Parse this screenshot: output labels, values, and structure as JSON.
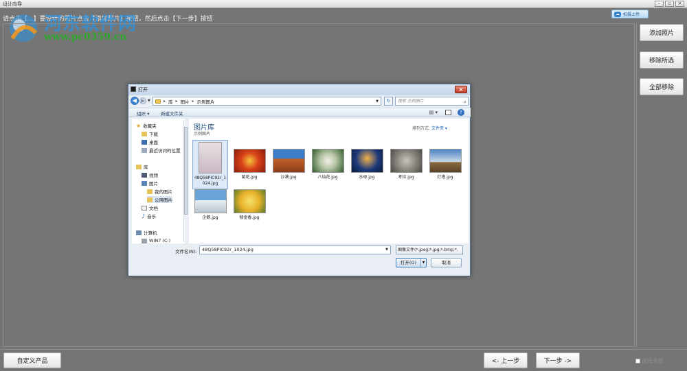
{
  "app": {
    "title": "设计向导",
    "instruction": "请点击【...】要设计的照片点击【添加照片】按钮，然后点击【下一步】按钮",
    "watermark": {
      "name": "河东软件网",
      "url": "www.pc0359.cn"
    },
    "upload_label": "拍摄上传"
  },
  "side_buttons": {
    "add": "添加照片",
    "remove_selected": "移除所选",
    "remove_all": "全部移除"
  },
  "bottom": {
    "custom": "自定义产品",
    "prev": "<- 上一步",
    "next": "下一步 ->",
    "select_all": "选择全部"
  },
  "dialog": {
    "title": "打开",
    "breadcrumb": [
      "库",
      "图片",
      "示例图片"
    ],
    "search_placeholder": "搜索 示例图片",
    "organize": "组织 ▾",
    "new_folder": "新建文件夹",
    "library_title": "图片库",
    "library_sub": "示例图片",
    "arrange_label": "排列方式:",
    "arrange_value": "文件夹 ▾",
    "nav": {
      "favorites": "收藏夹",
      "downloads": "下载",
      "desktop": "桌面",
      "recent": "最近访问的位置",
      "libraries": "库",
      "videos": "视频",
      "pictures": "图片",
      "my_pictures": "我的图片",
      "public_pictures": "公用图片",
      "documents": "文档",
      "music": "音乐",
      "computer": "计算机",
      "drive": "WIN7 (C:)"
    },
    "files": [
      {
        "label": "48Q58PIC92r_1024.jpg",
        "icon": "portrait-thumbnail"
      },
      {
        "label": "菊花.jpg",
        "icon": "chrysanthemum-thumbnail"
      },
      {
        "label": "沙漠.jpg",
        "icon": "desert-thumbnail"
      },
      {
        "label": "八仙花.jpg",
        "icon": "hydrangea-thumbnail"
      },
      {
        "label": "水母.jpg",
        "icon": "jellyfish-thumbnail"
      },
      {
        "label": "考拉.jpg",
        "icon": "koala-thumbnail"
      },
      {
        "label": "灯塔.jpg",
        "icon": "lighthouse-thumbnail"
      },
      {
        "label": "企鹅.jpg",
        "icon": "penguins-thumbnail"
      },
      {
        "label": "郁金香.jpg",
        "icon": "tulips-thumbnail"
      }
    ],
    "filename_label": "文件名(N):",
    "filename_value": "48Q58PIC92r_1024.jpg",
    "filetype_value": "图像文件(*.jpeg;*.jpg;*.bmp;*.",
    "open": "打开(O)",
    "cancel": "取消"
  }
}
